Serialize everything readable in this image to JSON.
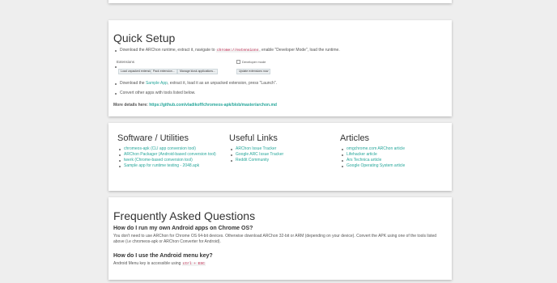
{
  "setup": {
    "title": "Quick Setup",
    "step1_pre": "Download the ARChon runtime, extract it, navigate to",
    "step1_code": "chrome://extensions",
    "step1_post": ", enable \"Developer Mode\", load the runtime.",
    "ext_title": "Extensions",
    "ext_dev": "Developer mode",
    "ext_buttons": [
      "Load unpacked extension...",
      "Pack extension...",
      "Manage kiosk applications...",
      "Update extensions now"
    ],
    "step2_pre": "Download the",
    "step2_link": "Sample App",
    "step2_post": ", extract it, load it as an unpacked extension, press \"Launch\".",
    "step3": "Convert other apps with tools listed below.",
    "more_label": "More details here:",
    "more_link": "https://github.com/vladikoff/chromeos-apk/blob/master/archon.md"
  },
  "columns": [
    {
      "title": "Software / Utilities",
      "items": [
        "chromeos-apk (CLI app conversion tool)",
        "ARChon Packager (Android-based conversion tool)",
        "twerk (Chrome-based conversion tool)",
        "Sample app for runtime testing - 2048.apk"
      ]
    },
    {
      "title": "Useful Links",
      "items": [
        "ARChon Issue Tracker",
        "Google ARC Issue Tracker",
        "Reddit Community"
      ]
    },
    {
      "title": "Articles",
      "items": [
        "omgchrome.com ARChon article",
        "Lifehacker article",
        "Ars Technica article",
        "Google Operating System article"
      ]
    }
  ],
  "faq": {
    "title": "Frequently Asked Questions",
    "q1": "How do I run my own Android apps on Chrome OS?",
    "a1": "You don't need to use ARChon for Chrome OS 64-bit devices. Otherwise download ARChon 32-bit or ARM (depending on your device). Convert the APK using one of the tools listed above (i.e chromeos-apk or ARChon Converter for Android).",
    "q2": "How do I use the Android menu key?",
    "a2_pre": "Android Menu key is accessible using",
    "a2_code": "ctrl + ESC"
  },
  "colors": {
    "link": "#26a69a",
    "code": "#c7254e",
    "background": "#eeeeee",
    "card": "#ffffff"
  }
}
